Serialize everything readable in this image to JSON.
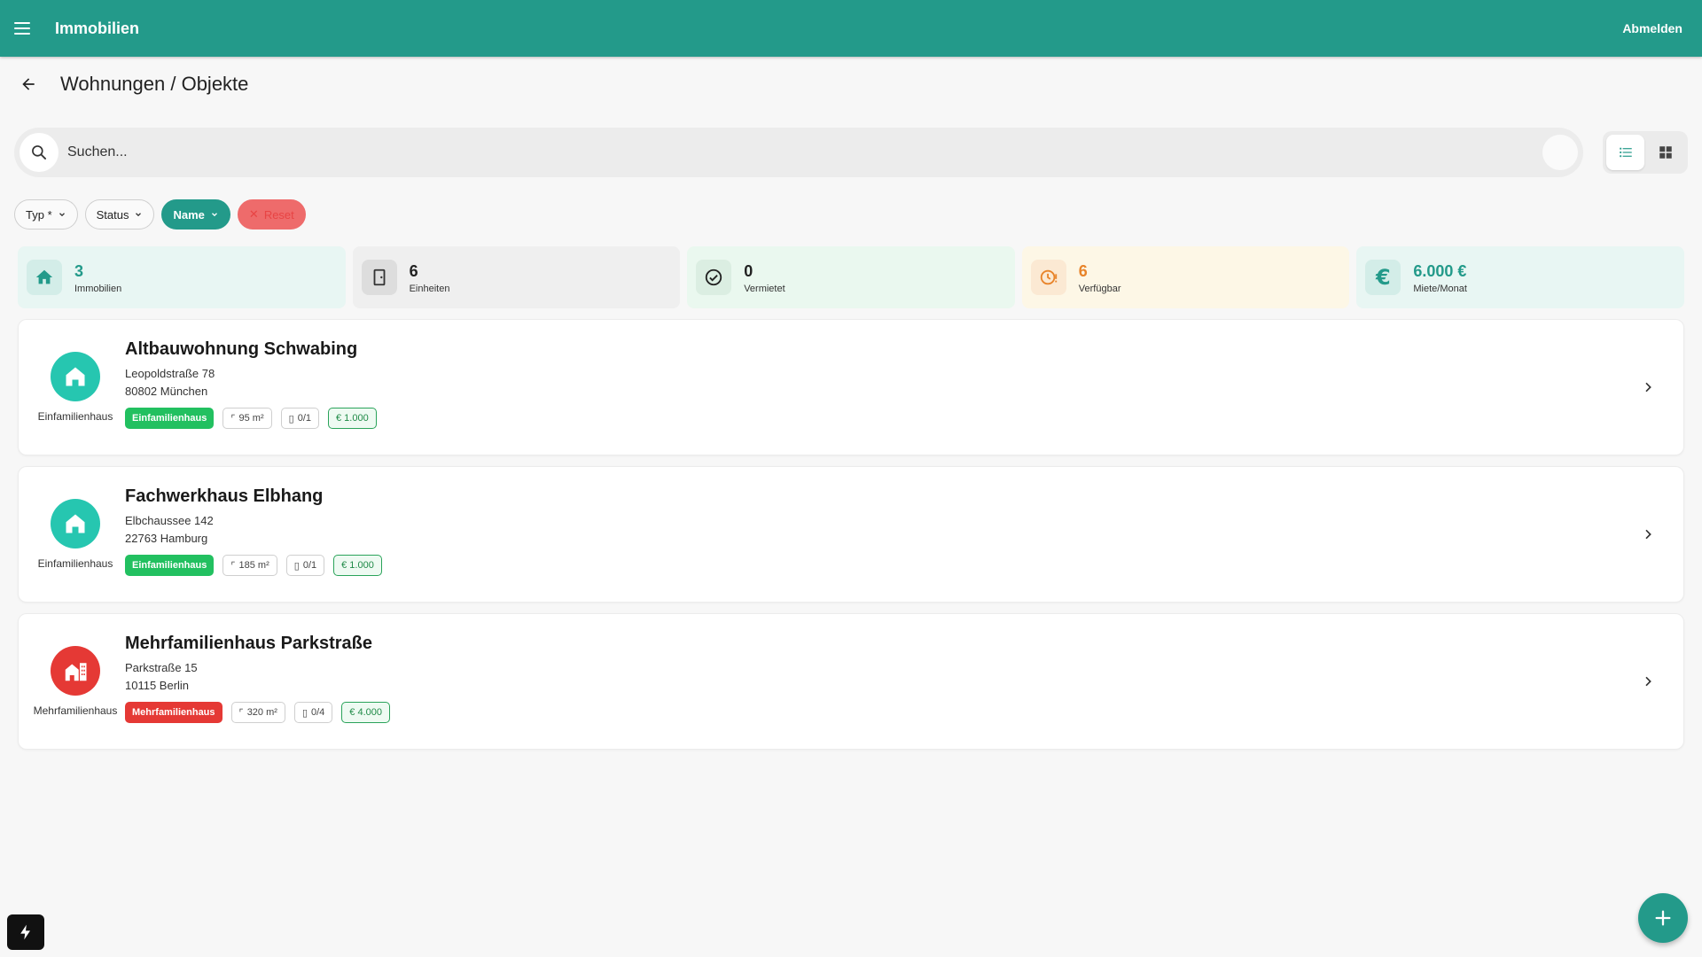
{
  "appbar": {
    "title": "Immobilien",
    "logout_label": "Abmelden"
  },
  "page": {
    "title": "Wohnungen / Objekte"
  },
  "search": {
    "placeholder": "Suchen..."
  },
  "filters": {
    "type_label": "Typ *",
    "status_label": "Status",
    "sort_label": "Name",
    "reset_label": "Reset"
  },
  "stats": [
    {
      "value": "3",
      "label": "Immobilien",
      "icon": "home-icon",
      "bg": "#e8f6f3",
      "icon_bg": "#d3ede8",
      "color": "#239a8a"
    },
    {
      "value": "6",
      "label": "Einheiten",
      "icon": "door-icon",
      "bg": "#efefef",
      "icon_bg": "#dddddd",
      "color": "#222222"
    },
    {
      "value": "0",
      "label": "Vermietet",
      "icon": "check-circle-icon",
      "bg": "#eaf8ef",
      "icon_bg": "#dbeee2",
      "color": "#222222"
    },
    {
      "value": "6",
      "label": "Verfügbar",
      "icon": "clock-alert-icon",
      "bg": "#fdf7e6",
      "icon_bg": "#fbe9d3",
      "color": "#e8842a"
    },
    {
      "value": "6.000 €",
      "label": "Miete/Monat",
      "icon": "euro-icon",
      "bg": "#e8f6f3",
      "icon_bg": "#d3ede8",
      "color": "#239a8a"
    }
  ],
  "properties": [
    {
      "title": "Altbauwohnung Schwabing",
      "street": "Leopoldstraße 78",
      "city": "80802 München",
      "type_label": "Einfamilienhaus",
      "type_tag": "Einfamilienhaus",
      "type_color": "#22c060",
      "avatar_color": "#26c6b0",
      "avatar_icon": "house-icon",
      "area": "95 m²",
      "units": "0/1",
      "rent": "€ 1.000"
    },
    {
      "title": "Fachwerkhaus Elbhang",
      "street": "Elbchaussee 142",
      "city": "22763 Hamburg",
      "type_label": "Einfamilienhaus",
      "type_tag": "Einfamilienhaus",
      "type_color": "#22c060",
      "avatar_color": "#26c6b0",
      "avatar_icon": "house-icon",
      "area": "185 m²",
      "units": "0/1",
      "rent": "€ 1.000"
    },
    {
      "title": "Mehrfamilienhaus Parkstraße",
      "street": "Parkstraße 15",
      "city": "10115 Berlin",
      "type_label": "Mehrfamilienhaus",
      "type_tag": "Mehrfamilienhaus",
      "type_color": "#e53935",
      "avatar_color": "#e53935",
      "avatar_icon": "apartment-building-icon",
      "area": "320 m²",
      "units": "0/4",
      "rent": "€ 4.000"
    }
  ]
}
